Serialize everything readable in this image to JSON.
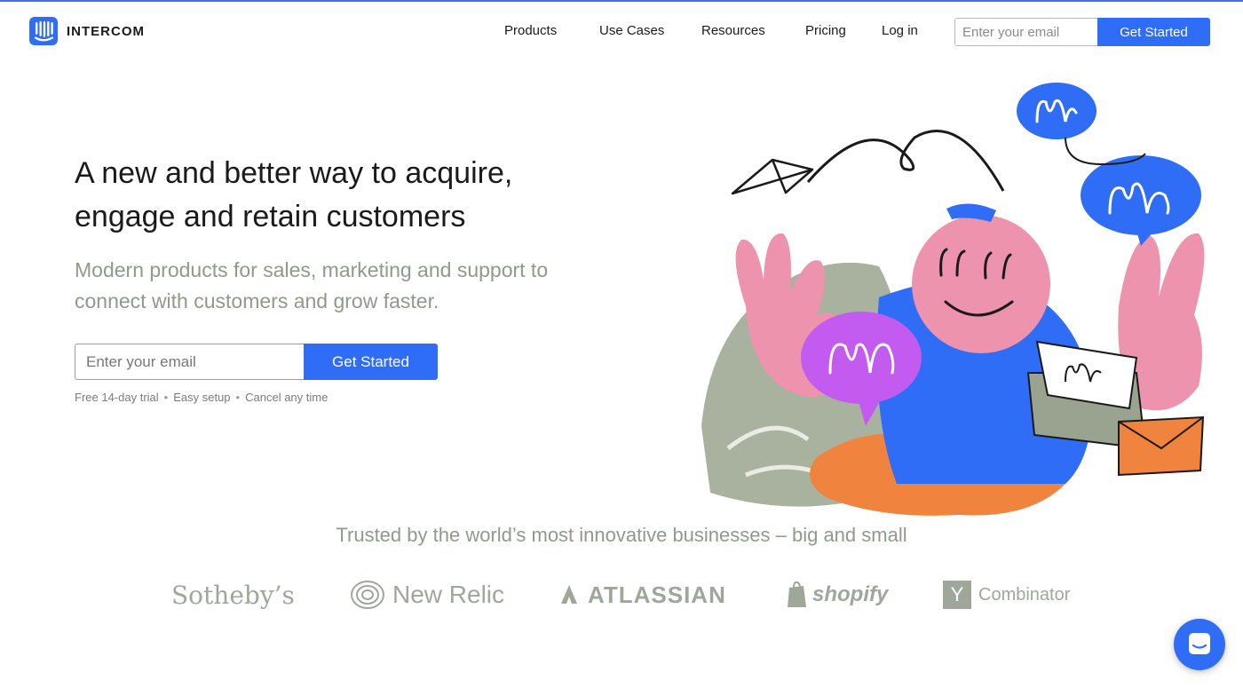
{
  "header": {
    "brand": "INTERCOM",
    "nav": [
      {
        "label": "Products"
      },
      {
        "label": "Use Cases"
      },
      {
        "label": "Resources"
      },
      {
        "label": "Pricing"
      },
      {
        "label": "Log in"
      }
    ],
    "email_placeholder": "Enter your email",
    "cta_label": "Get Started"
  },
  "hero": {
    "title_line1": "A new and better way to acquire,",
    "title_line2": "engage and retain customers",
    "subtitle_line1": "Modern products for sales, marketing and support to",
    "subtitle_line2": "connect with customers and grow faster.",
    "email_placeholder": "Enter your email",
    "cta_label": "Get Started",
    "notes": [
      "Free 14-day trial",
      "Easy setup",
      "Cancel any time"
    ],
    "note_separator": "•"
  },
  "trusted": {
    "heading": "Trusted by the world’s most innovative businesses – big and small",
    "logos": [
      "Sotheby’s",
      "New Relic",
      "ATLASSIAN",
      "shopify",
      "Y",
      "Combinator"
    ]
  },
  "icons": {
    "brand_mark": "intercom-logo-icon",
    "launcher": "messenger-launcher-icon"
  },
  "colors": {
    "accent": "#2f6df6",
    "muted_green": "#8e9a8a",
    "pink": "#ee93ad",
    "purple": "#c35bf0",
    "orange": "#f0843f",
    "gray_green": "#9aa38f"
  }
}
